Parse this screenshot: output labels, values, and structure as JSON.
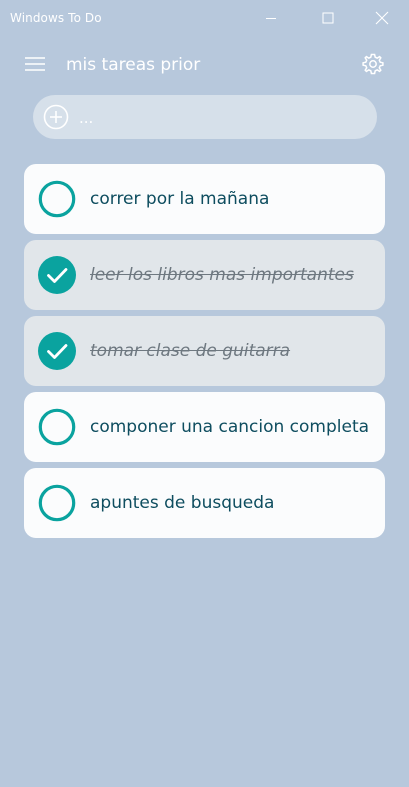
{
  "window": {
    "title": "Windows To Do",
    "controls": [
      "minimize-icon",
      "maximize-icon",
      "close-icon"
    ]
  },
  "header": {
    "title": "mis tareas prior",
    "menu_icon": "hamburger-menu-icon",
    "settings_icon": "gear-icon"
  },
  "add_task": {
    "icon": "add-circle-icon",
    "placeholder": "...",
    "value": ""
  },
  "tasks": [
    {
      "label": "correr por la mañana",
      "completed": false
    },
    {
      "label": "leer los libros mas importantes",
      "completed": true
    },
    {
      "label": "tomar clase de guitarra",
      "completed": true
    },
    {
      "label": "componer una cancion completa",
      "completed": false
    },
    {
      "label": "apuntes de busqueda",
      "completed": false
    }
  ],
  "colors": {
    "background": "#b7c8dc",
    "accent": "#0aa39f",
    "task_text": "#0e4d5f",
    "card": "#fbfcfd",
    "card_done": "#e1e6ea"
  }
}
